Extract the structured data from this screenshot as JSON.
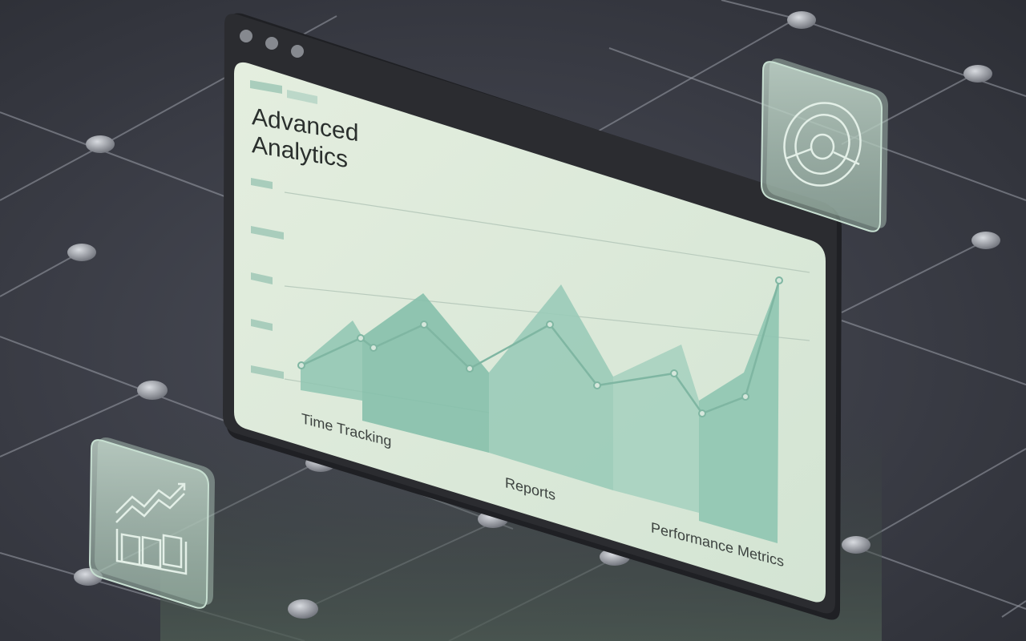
{
  "window": {
    "title_line1": "Advanced",
    "title_line2": "Analytics"
  },
  "chart_labels": {
    "time_tracking": "Time Tracking",
    "reports": "Reports",
    "performance_metrics": "Performance Metrics"
  },
  "icons": {
    "left_card": "bar-trend-chart-icon",
    "right_card": "donut-gauge-icon"
  },
  "colors": {
    "background": "#3a3c45",
    "window_frame": "#2b2c30",
    "screen": "#dce8d8",
    "area_fill": "#8cc4b0",
    "line": "#7fb6a2",
    "accent_card": "#a9c9b7"
  }
}
